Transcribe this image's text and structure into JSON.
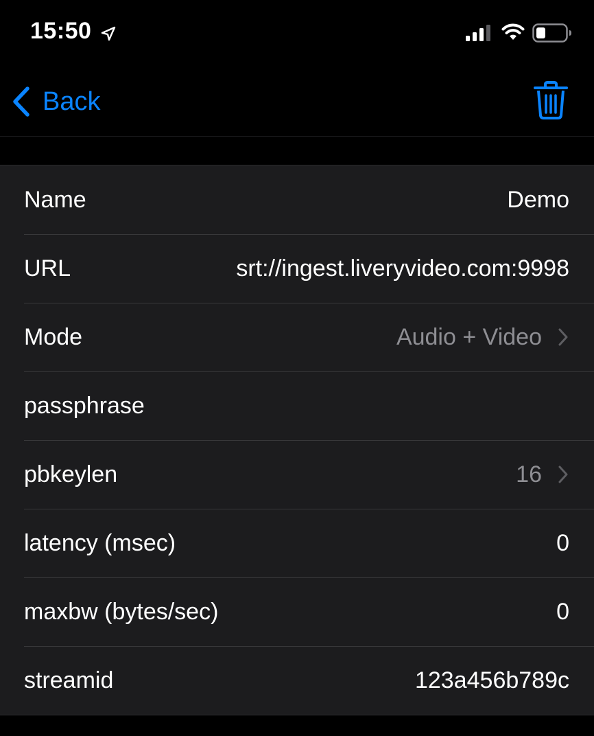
{
  "status_bar": {
    "time": "15:50",
    "icons": [
      "location-arrow-icon",
      "cellular-signal-icon",
      "wifi-icon",
      "battery-icon"
    ]
  },
  "nav": {
    "back_label": "Back",
    "trash_icon": "trash-icon",
    "accent_color": "#0a84ff"
  },
  "settings": {
    "rows": [
      {
        "label": "Name",
        "value": "Demo"
      },
      {
        "label": "URL",
        "value": "srt://ingest.liveryvideo.com:9998"
      },
      {
        "label": "Mode",
        "value": "Audio + Video",
        "disclosure": true
      },
      {
        "label": "passphrase",
        "value": ""
      },
      {
        "label": "pbkeylen",
        "value": "16",
        "disclosure": true
      },
      {
        "label": "latency (msec)",
        "value": "0"
      },
      {
        "label": "maxbw (bytes/sec)",
        "value": "0"
      },
      {
        "label": "streamid",
        "value": "123a456b789c"
      }
    ]
  },
  "colors": {
    "background": "#000000",
    "cell_background": "#1c1c1e",
    "secondary_text": "#8e8e93",
    "separator": "#38383a"
  }
}
